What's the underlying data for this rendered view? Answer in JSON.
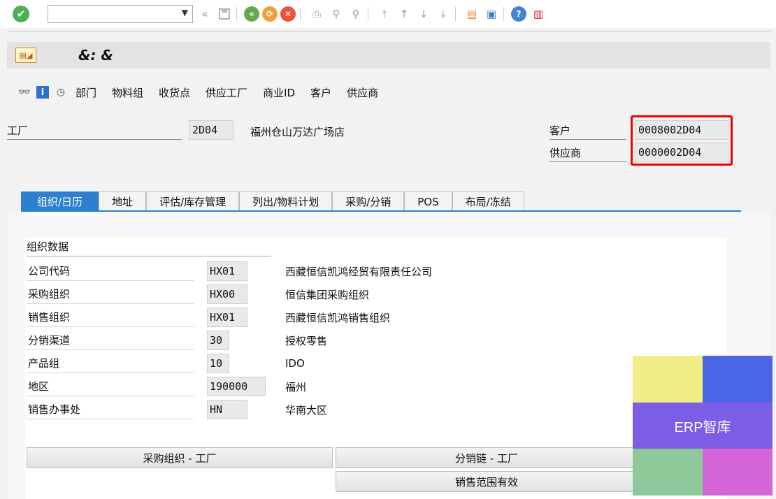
{
  "toolbar": {
    "ok_glyph": "✔",
    "command_value": "",
    "icons": [
      "back-icon",
      "save-icon",
      "back-nav-icon",
      "exit-icon",
      "cancel-icon",
      "print-icon",
      "find-icon",
      "find-next-icon",
      "first-page-icon",
      "prev-page-icon",
      "next-page-icon",
      "last-page-icon",
      "create-session-icon",
      "shortcut-icon",
      "help-icon",
      "customize-layout-icon"
    ]
  },
  "title": "&: &",
  "app_toolbar": {
    "items": [
      "部门",
      "物料组",
      "收货点",
      "供应工厂",
      "商业ID",
      "客户",
      "供应商"
    ]
  },
  "header": {
    "plant_label": "工厂",
    "plant_code": "2D04",
    "plant_name": "福州仓山万达广场店",
    "customer_label": "客户",
    "customer_value": "0008002D04",
    "vendor_label": "供应商",
    "vendor_value": "0000002D04"
  },
  "tabs": [
    "组织/日历",
    "地址",
    "评估/库存管理",
    "列出/物料计划",
    "采购/分销",
    "POS",
    "布局/冻结"
  ],
  "org_group": {
    "title": "组织数据",
    "rows": [
      {
        "label": "公司代码",
        "value": "HX01",
        "desc": "西藏恒信凯鸿经贸有限责任公司"
      },
      {
        "label": "采购组织",
        "value": "HX00",
        "desc": "恒信集团采购组织"
      },
      {
        "label": "销售组织",
        "value": "HX01",
        "desc": "西藏恒信凯鸿销售组织"
      },
      {
        "label": "分销渠道",
        "value": "30",
        "desc": "授权零售"
      },
      {
        "label": "产品组",
        "value": "10",
        "desc": "IDO"
      },
      {
        "label": "地区",
        "value": "190000",
        "desc": "福州"
      },
      {
        "label": "销售办事处",
        "value": "HN",
        "desc": "华南大区"
      }
    ]
  },
  "buttons": {
    "purch_org_plant": "采购组织 - 工厂",
    "dist_chain_plant": "分销链 - 工厂",
    "sales_area_valid": "销售范围有效"
  },
  "watermark": {
    "text": "ERP智库",
    "colors": [
      "#f2ec86",
      "#4a66e6",
      "#7b5de6",
      "#8ec99a",
      "#d566d8"
    ]
  }
}
